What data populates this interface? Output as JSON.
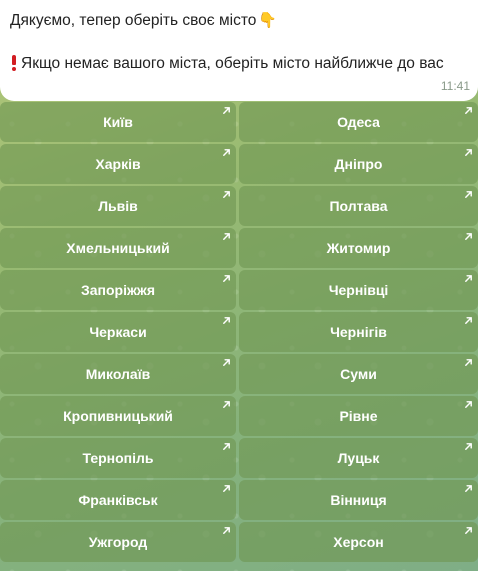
{
  "message": {
    "line1": "Дякуємо, тепер оберіть своє місто",
    "line1_emoji": "👇",
    "line2": "Якщо немає вашого міста, оберіть місто найближче до вас",
    "time": "11:41"
  },
  "icons": {
    "warning": "exclamation-icon",
    "pointing_down": "pointing-down-icon",
    "button_arrow": "arrow-up-right-icon"
  },
  "colors": {
    "warning": "#d21d22",
    "button_text": "#ffffff",
    "bubble": "#ffffff"
  },
  "keyboard": {
    "buttons": [
      "Київ",
      "Одеса",
      "Харків",
      "Дніпро",
      "Львів",
      "Полтава",
      "Хмельницький",
      "Житомир",
      "Запоріжжя",
      "Чернівці",
      "Черкаси",
      "Чернігів",
      "Миколаїв",
      "Суми",
      "Кропивницький",
      "Рівне",
      "Тернопіль",
      "Луцьк",
      "Франківськ",
      "Вінниця",
      "Ужгород",
      "Херсон"
    ]
  }
}
